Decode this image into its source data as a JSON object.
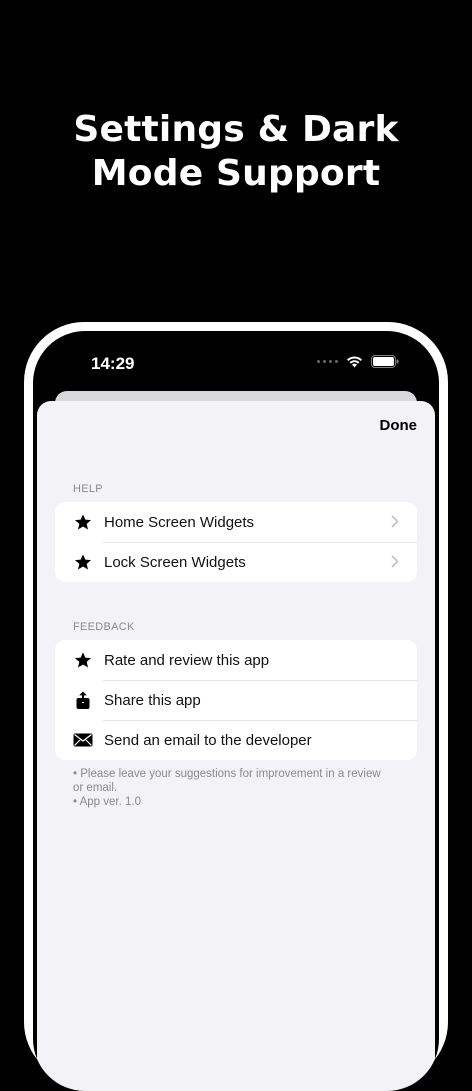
{
  "headline": {
    "line1": "Settings & Dark",
    "line2": "Mode Support"
  },
  "status_bar": {
    "time": "14:29",
    "icons": [
      "signal-dots-icon",
      "wifi-icon",
      "battery-icon"
    ]
  },
  "sheet": {
    "done_label": "Done",
    "help": {
      "header": "HELP",
      "items": [
        {
          "label": "Home Screen Widgets",
          "icon": "star-icon"
        },
        {
          "label": "Lock Screen Widgets",
          "icon": "star-icon"
        }
      ]
    },
    "feedback": {
      "header": "FEEDBACK",
      "items": [
        {
          "label": "Rate and review this app",
          "icon": "star-icon"
        },
        {
          "label": "Share this app",
          "icon": "share-icon"
        },
        {
          "label": "Send an email to the developer",
          "icon": "envelope-icon"
        }
      ]
    },
    "footnotes": [
      "• Please leave your suggestions for improvement in a review or email.",
      "• App ver. 1.0"
    ]
  },
  "colors": {
    "background": "#000000",
    "sheet": "#f2f2f7",
    "card": "#ffffff",
    "secondary_text": "#8a8a8e"
  }
}
